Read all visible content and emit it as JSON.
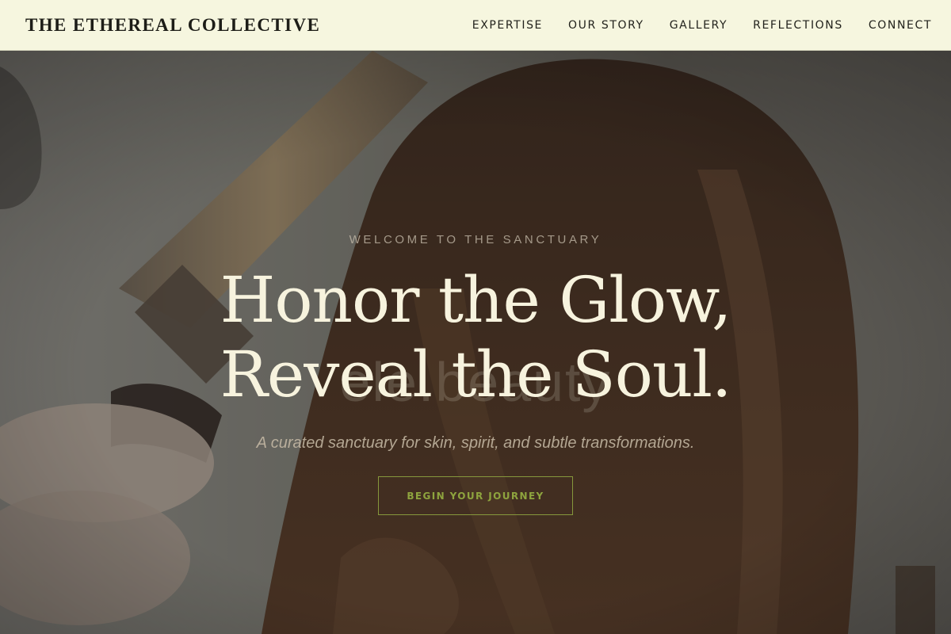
{
  "brand": {
    "name": "THE ETHEREAL COLLECTIVE"
  },
  "nav": {
    "items": [
      {
        "label": "EXPERTISE"
      },
      {
        "label": "OUR STORY"
      },
      {
        "label": "GALLERY"
      },
      {
        "label": "REFLECTIONS"
      },
      {
        "label": "CONNECT"
      }
    ]
  },
  "hero": {
    "eyebrow": "WELCOME TO THE SANCTUARY",
    "headline_line1": "Honor the Glow,",
    "headline_line2": "Reveal the Soul.",
    "ghost_word": "ele.beauty",
    "tagline": "A curated sanctuary for skin, spirit, and subtle transformations.",
    "cta_label": "BEGIN YOUR JOURNEY"
  },
  "colors": {
    "nav_background": "#f6f6df",
    "headline": "#f7f3de",
    "accent": "#8ea43e"
  }
}
